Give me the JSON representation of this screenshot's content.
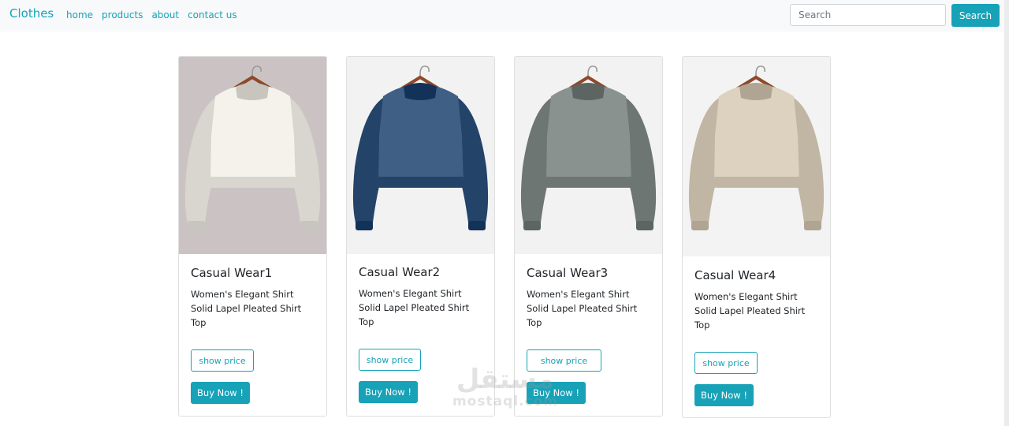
{
  "navbar": {
    "brand": "Clothes",
    "links": [
      "home",
      "products",
      "about",
      "contact us"
    ],
    "search": {
      "placeholder": "Search",
      "button_label": "Search"
    }
  },
  "products": [
    {
      "title": "Casual Wear1",
      "description": "Women's Elegant Shirt Solid Lapel Pleated Shirt Top",
      "price_button": "show price",
      "buy_button": "Buy Now !",
      "sweater_color": "#f4f2ea",
      "background_color": "#cbc3c3"
    },
    {
      "title": "Casual Wear2",
      "description": "Women's Elegant Shirt Solid Lapel Pleated Shirt Top",
      "price_button": "show price",
      "buy_button": "Buy Now !",
      "sweater_color": "#3f5f85",
      "background_color": "#f2f2f2"
    },
    {
      "title": "Casual Wear3",
      "description": "Women's Elegant Shirt Solid Lapel Pleated Shirt Top",
      "price_button": "show price",
      "buy_button": "Buy Now !",
      "sweater_color": "#8a9290",
      "background_color": "#f2f2f2"
    },
    {
      "title": "Casual Wear4",
      "description": "Women's Elegant Shirt Solid Lapel Pleated Shirt Top",
      "price_button": "show price",
      "buy_button": "Buy Now !",
      "sweater_color": "#ddd2bf",
      "background_color": "#f3f3f3"
    }
  ],
  "watermark": {
    "arabic": "مستقل",
    "latin": "mostaql.com"
  },
  "colors": {
    "accent": "#17a2b8",
    "navbar_bg": "#f8f9fa",
    "hanger_wood": "#8c4a2a"
  }
}
